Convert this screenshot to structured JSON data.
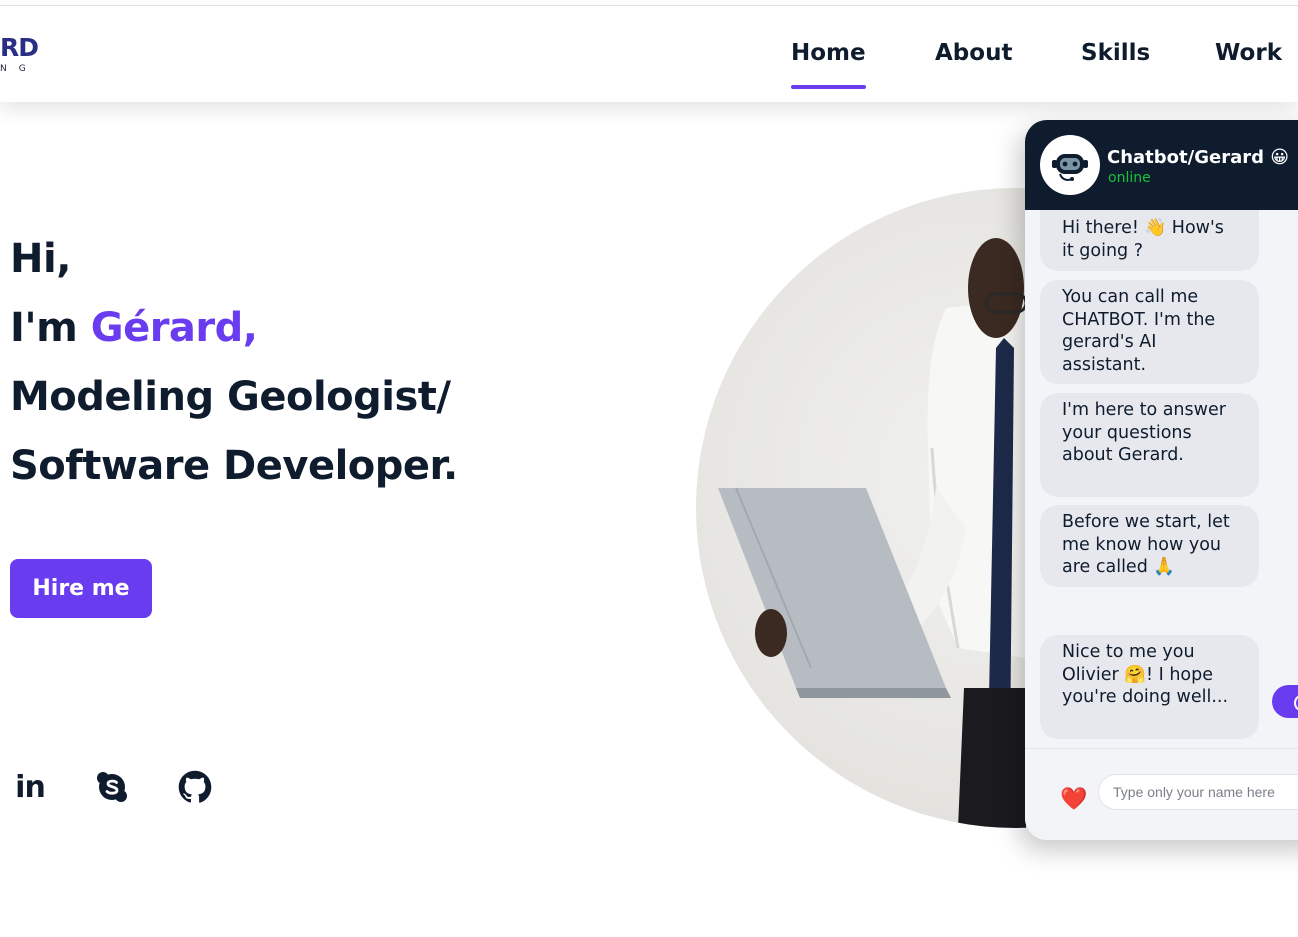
{
  "logo": {
    "main": "RD",
    "sub": "NG"
  },
  "nav": [
    {
      "label": "Home",
      "active": true
    },
    {
      "label": "About",
      "active": false
    },
    {
      "label": "Skills",
      "active": false
    },
    {
      "label": "Work",
      "active": false
    }
  ],
  "hero": {
    "line1": "Hi,",
    "line2_prefix": "I'm ",
    "line2_name": "Gérard,",
    "line3": "Modeling Geologist/",
    "line4": "Software Developer.",
    "hire_label": "Hire me"
  },
  "socials": [
    {
      "icon": "linkedin-icon",
      "label": "in"
    },
    {
      "icon": "skype-icon"
    },
    {
      "icon": "github-icon"
    }
  ],
  "chat": {
    "title": "Chatbot/Gerard 😀",
    "status": "online",
    "messages": [
      "Hi there! 👋 How's it going ?",
      "You can call me CHATBOT. I'm the gerard's AI assistant.",
      "I'm here to answer your questions about Gerard.",
      "Before we start, let me know how you are called 🙏",
      "Nice to me you Olivier 🤗! I hope you're doing well..."
    ],
    "footer_icon": "❤️",
    "input_placeholder": "Type only your name here"
  },
  "colors": {
    "accent": "#6a3cf0",
    "navy": "#0f1c2e",
    "online": "#18c23a"
  }
}
